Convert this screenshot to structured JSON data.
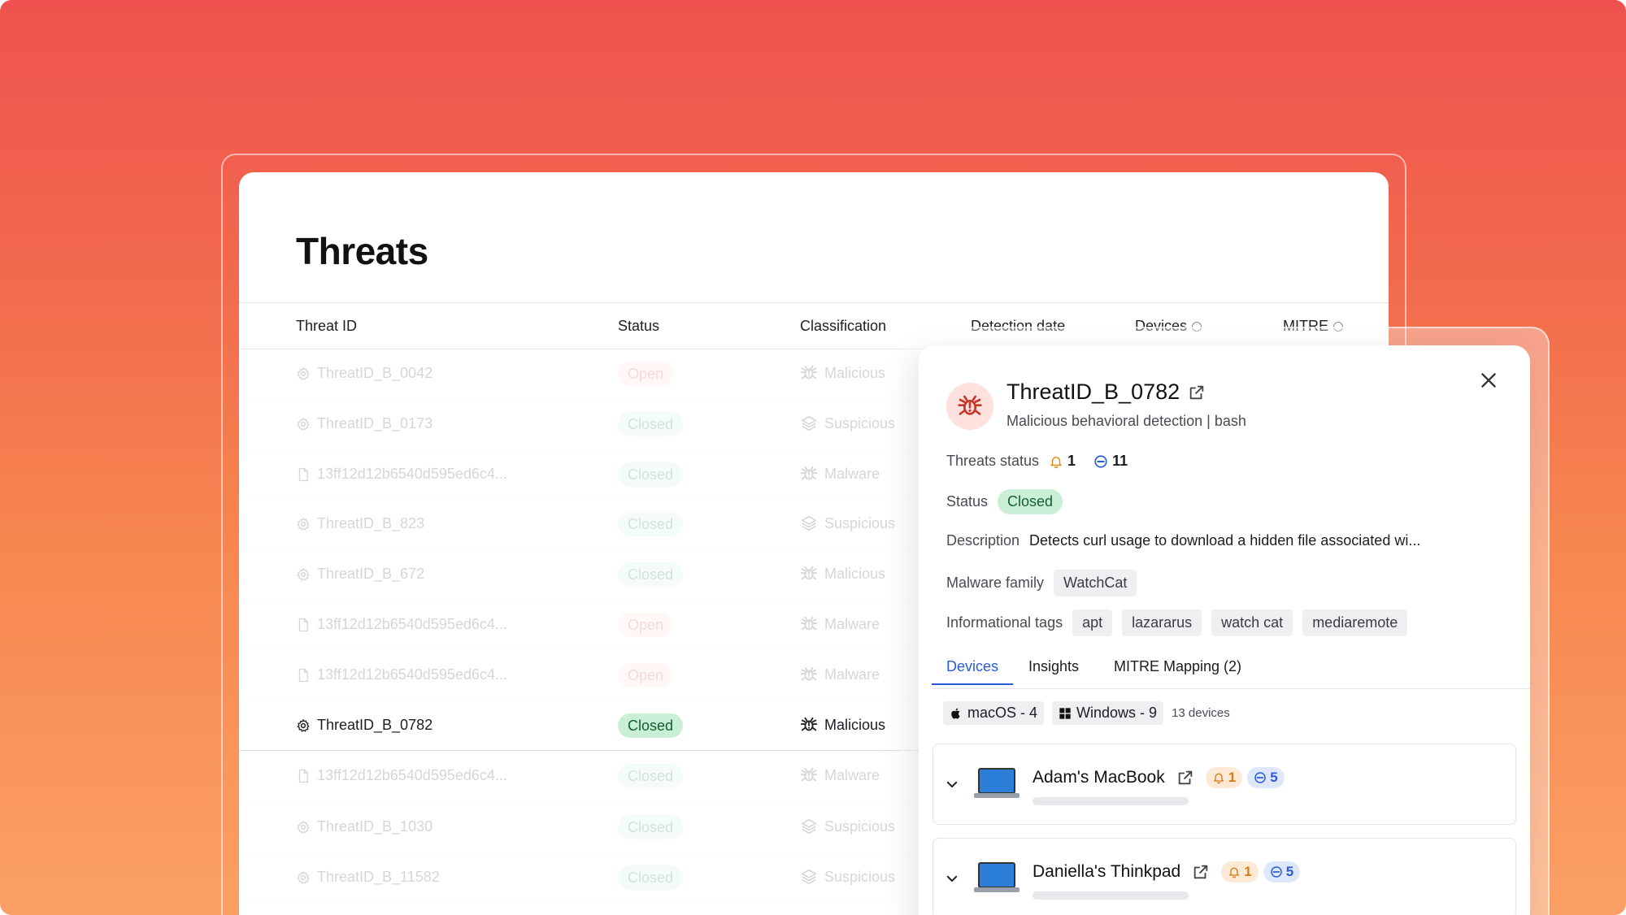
{
  "page": {
    "title": "Threats"
  },
  "table": {
    "headers": {
      "threat_id": "Threat ID",
      "status": "Status",
      "classification": "Classification",
      "detection_date": "Detection date",
      "devices": "Devices",
      "mitre": "MITRE"
    },
    "rows": [
      {
        "id": "ThreatID_B_0042",
        "icon": "gear-icon",
        "status": "Open",
        "classification": "Malicious",
        "class_icon": "bug-icon"
      },
      {
        "id": "ThreatID_B_0173",
        "icon": "gear-icon",
        "status": "Closed",
        "classification": "Suspicious",
        "class_icon": "layers-icon"
      },
      {
        "id": "13ff12d12b6540d595ed6c4...",
        "icon": "file-icon",
        "status": "Closed",
        "classification": "Malware",
        "class_icon": "bug-icon"
      },
      {
        "id": "ThreatID_B_823",
        "icon": "gear-icon",
        "status": "Closed",
        "classification": "Suspicious",
        "class_icon": "layers-icon"
      },
      {
        "id": "ThreatID_B_672",
        "icon": "gear-icon",
        "status": "Closed",
        "classification": "Malicious",
        "class_icon": "bug-icon"
      },
      {
        "id": "13ff12d12b6540d595ed6c4...",
        "icon": "file-icon",
        "status": "Open",
        "classification": "Malware",
        "class_icon": "bug-icon"
      },
      {
        "id": "13ff12d12b6540d595ed6c4...",
        "icon": "file-icon",
        "status": "Open",
        "classification": "Malware",
        "class_icon": "bug-icon"
      },
      {
        "id": "ThreatID_B_0782",
        "icon": "gear-icon",
        "status": "Closed",
        "classification": "Malicious",
        "class_icon": "bug-icon"
      },
      {
        "id": "13ff12d12b6540d595ed6c4...",
        "icon": "file-icon",
        "status": "Closed",
        "classification": "Malware",
        "class_icon": "bug-icon"
      },
      {
        "id": "ThreatID_B_1030",
        "icon": "gear-icon",
        "status": "Closed",
        "classification": "Suspicious",
        "class_icon": "layers-icon"
      },
      {
        "id": "ThreatID_B_11582",
        "icon": "gear-icon",
        "status": "Closed",
        "classification": "Suspicious",
        "class_icon": "layers-icon"
      }
    ]
  },
  "detail": {
    "title": "ThreatID_B_0782",
    "subtitle": "Malicious behavioral detection | bash",
    "threats_status_label": "Threats status",
    "alerts_count": "1",
    "blocked_count": "11",
    "status_label": "Status",
    "status_value": "Closed",
    "description_label": "Description",
    "description_value": "Detects curl usage to download a hidden file associated wi...",
    "malware_family_label": "Malware family",
    "malware_family_value": "WatchCat",
    "tags_label": "Informational tags",
    "tags": [
      "apt",
      "lazararus",
      "watch cat",
      "mediaremote"
    ],
    "tabs": [
      "Devices",
      "Insights",
      "MITRE Mapping (2)"
    ],
    "os_summary": {
      "macos": "macOS - 4",
      "windows": "Windows - 9",
      "total": "13 devices"
    },
    "devices": [
      {
        "name": "Adam's MacBook",
        "alerts": "1",
        "blocked": "5"
      },
      {
        "name": "Daniella's Thinkpad",
        "alerts": "1",
        "blocked": "5"
      }
    ]
  },
  "colors": {
    "accent": "#2a5bd7",
    "closed_bg": "#c9f0d6",
    "open_bg": "#ffd9d6",
    "warn": "#d67a1a",
    "danger": "#c5372c"
  }
}
